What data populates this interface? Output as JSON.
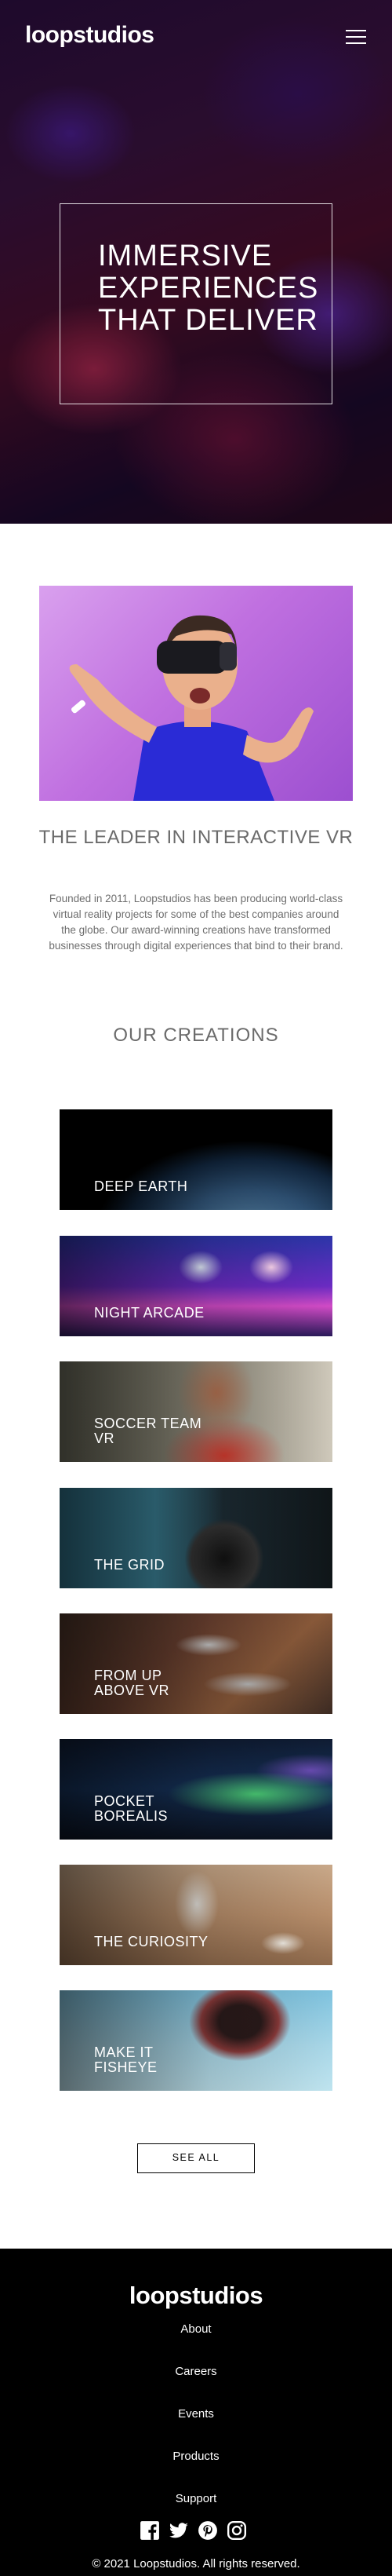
{
  "header": {
    "logo": "loopstudios",
    "menu_icon": "hamburger-icon"
  },
  "hero": {
    "title": "Immersive experiences that deliver"
  },
  "about": {
    "image": "man-in-vr-headset",
    "heading": "The leader in interactive VR",
    "text": "Founded in 2011, Loopstudios has been producing world-class virtual reality projects for some of the best companies around the globe. Our award-winning creations have transformed businesses through digital experiences that bind to their brand."
  },
  "creations": {
    "heading": "Our creations",
    "items": [
      {
        "label": "Deep earth"
      },
      {
        "label": "Night arcade"
      },
      {
        "label": "Soccer team VR"
      },
      {
        "label": "The grid"
      },
      {
        "label": "From up above VR"
      },
      {
        "label": "Pocket borealis"
      },
      {
        "label": "The curiosity"
      },
      {
        "label": "Make it fisheye"
      }
    ],
    "see_all": "SEE ALL"
  },
  "footer": {
    "logo": "loopstudios",
    "links": [
      "About",
      "Careers",
      "Events",
      "Products",
      "Support"
    ],
    "social": [
      "facebook-icon",
      "twitter-icon",
      "pinterest-icon",
      "instagram-icon"
    ],
    "copyright": "© 2021 Loopstudios. All rights reserved."
  }
}
